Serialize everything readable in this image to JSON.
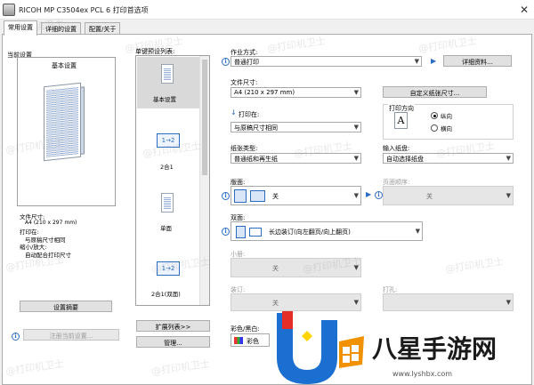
{
  "window": {
    "title": "RICOH MP C3504ex PCL 6 打印首选项"
  },
  "tabs": [
    "常用设置",
    "详细的设置",
    "配置/关于"
  ],
  "left_panel": {
    "current_settings_label": "当前设置",
    "preset_name": "基本设置",
    "info": {
      "paper_size_label": "文件尺寸:",
      "paper_size_value": "A4 (210 x 297 mm)",
      "print_on_label": "打印在:",
      "print_on_value": "与原稿尺寸相同",
      "reduce_label": "缩小/放大:",
      "reduce_value": "自动配合打印尺寸"
    },
    "summary_button": "设置摘要",
    "register_button": "注册当前设置..."
  },
  "preset_list": {
    "label": "单键预设列表:",
    "items": [
      {
        "label": "基本设置",
        "icon": "single-page-icon"
      },
      {
        "label": "2合1",
        "icon": "two-in-one-icon"
      },
      {
        "label": "单面",
        "icon": "single-sided-icon"
      },
      {
        "label": "2合1(双面)",
        "icon": "two-in-one-duplex-icon"
      }
    ],
    "expand_button": "扩展列表>>",
    "manage_button": "管理..."
  },
  "settings": {
    "job_type": {
      "label": "作业方式:",
      "value": "普通打印",
      "details_button": "详细资料..."
    },
    "document_size": {
      "label": "文件尺寸:",
      "value": "A4 (210 x 297 mm)",
      "custom_button": "自定义纸张尺寸..."
    },
    "print_on": {
      "label": "打印在:",
      "value": "与原稿尺寸相同"
    },
    "orientation": {
      "label": "打印方向",
      "portrait": "纵向",
      "landscape": "横向",
      "selected": "纵向"
    },
    "paper_type": {
      "label": "纸张类型:",
      "value": "普通纸和再生纸"
    },
    "input_tray": {
      "label": "输入纸盘:",
      "value": "自动选择纸盘"
    },
    "layout": {
      "label": "版面:",
      "value": "关"
    },
    "page_order": {
      "label": "页面顺序:",
      "value": "关"
    },
    "duplex": {
      "label": "双面:",
      "value": "长边装订(向左翻页/向上翻页)"
    },
    "booklet": {
      "label": "小册:",
      "value": "关"
    },
    "staple": {
      "label": "装订:",
      "value": "关"
    },
    "punch": {
      "label": "打孔:"
    },
    "color": {
      "label": "彩色/黑白:",
      "value": "彩色"
    }
  },
  "watermark": {
    "text": "@打印机卫士"
  },
  "brand": {
    "name": "八星手游网",
    "url": "www.lyshbx.com"
  },
  "colors": {
    "accent": "#2b6cc4",
    "border": "#adadad"
  }
}
